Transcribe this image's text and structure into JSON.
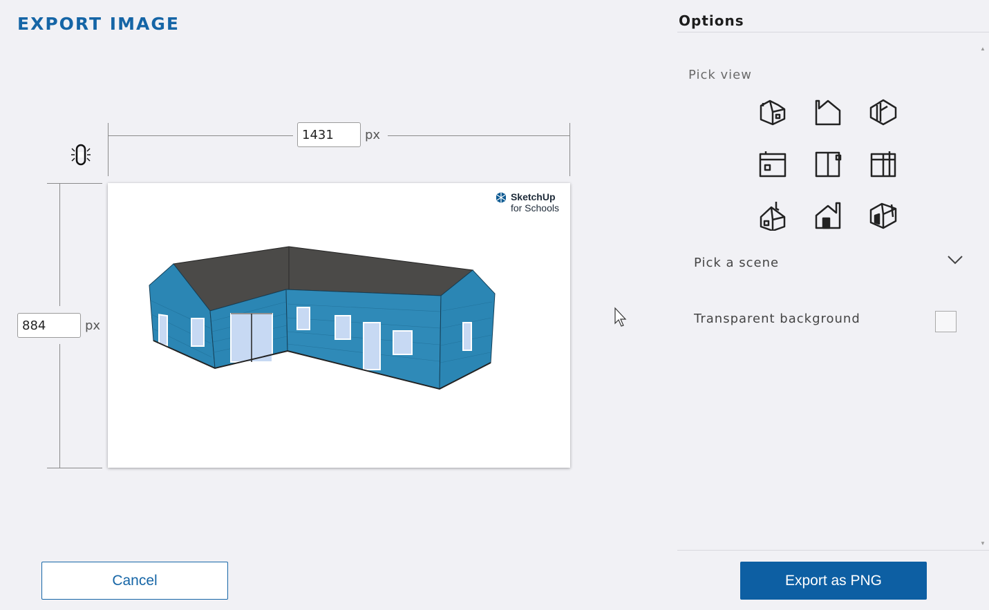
{
  "dialog": {
    "title": "EXPORT IMAGE"
  },
  "size": {
    "width": "1431",
    "height": "884",
    "unit": "px",
    "lock_icon": "link-icon"
  },
  "preview": {
    "brand_line1": "SketchUp",
    "brand_line2": "for Schools",
    "model": "house"
  },
  "options": {
    "title": "Options",
    "pick_view_label": "Pick view",
    "views": [
      {
        "icon": "iso-view-icon"
      },
      {
        "icon": "top-view-icon"
      },
      {
        "icon": "iso-top-view-icon"
      },
      {
        "icon": "front-view-icon"
      },
      {
        "icon": "right-view-icon"
      },
      {
        "icon": "back-view-icon"
      },
      {
        "icon": "left-iso-view-icon"
      },
      {
        "icon": "left-view-icon"
      },
      {
        "icon": "bottom-iso-view-icon"
      }
    ],
    "scene_label": "Pick a scene",
    "transparent_label": "Transparent background",
    "transparent_checked": false
  },
  "buttons": {
    "cancel": "Cancel",
    "export": "Export as PNG"
  },
  "colors": {
    "accent": "#1565a6",
    "primary_button": "#0d5fa3",
    "house_wall": "#2a84b3",
    "roof": "#4a4a4a"
  }
}
